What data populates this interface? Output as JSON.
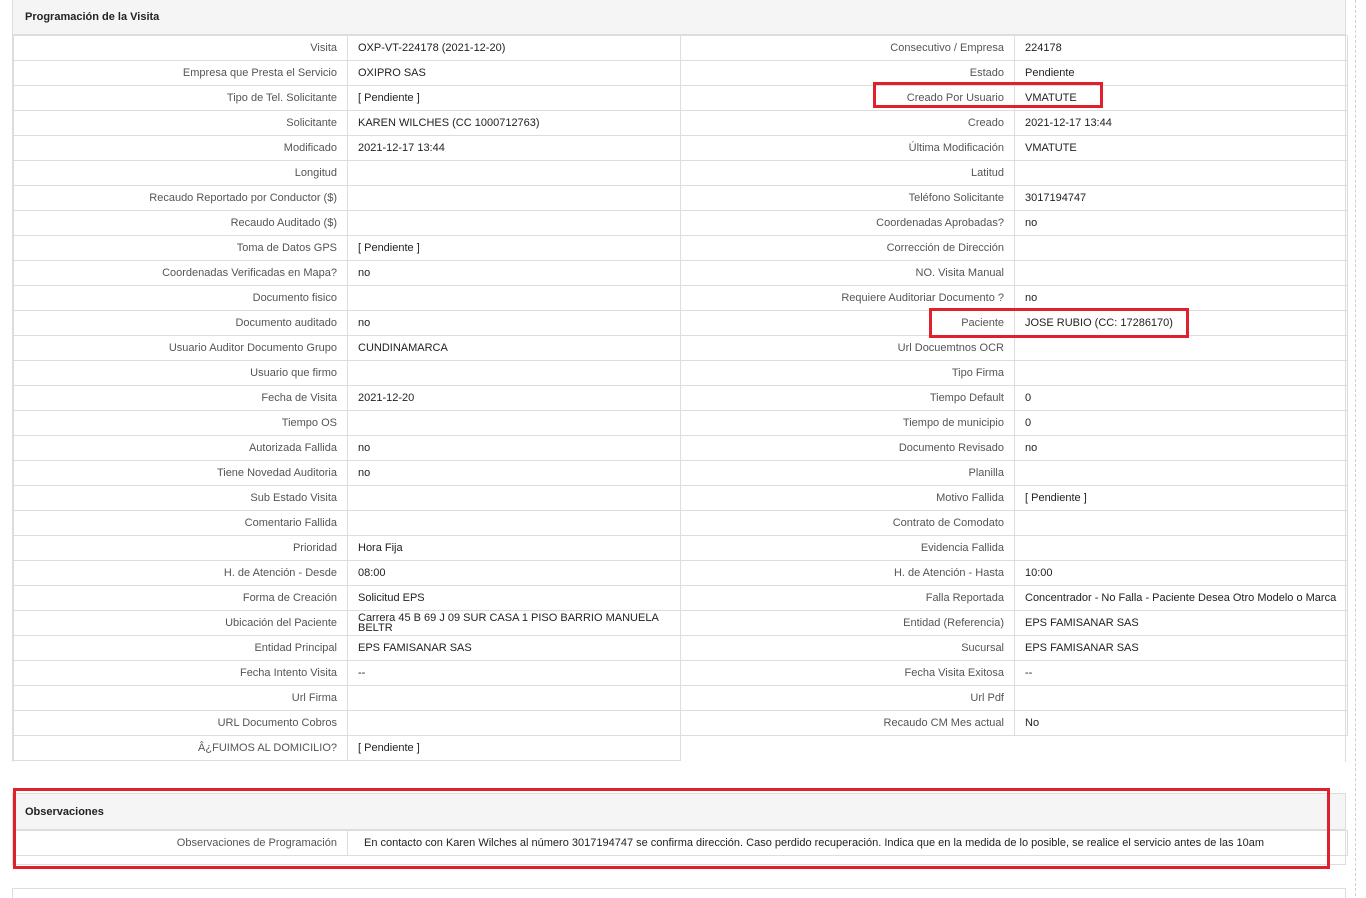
{
  "schedule": {
    "title": "Programación de la Visita",
    "rows": [
      {
        "l1": "Visita",
        "v1": "OXP-VT-224178 (2021-12-20)",
        "l2": "Consecutivo / Empresa",
        "v2": "224178"
      },
      {
        "l1": "Empresa que Presta el Servicio",
        "v1": "OXIPRO SAS",
        "l2": "Estado",
        "v2": "Pendiente"
      },
      {
        "l1": "Tipo de Tel. Solicitante",
        "v1": "[ Pendiente ]",
        "l2": "Creado Por Usuario",
        "v2": "VMATUTE"
      },
      {
        "l1": "Solicitante",
        "v1": "KAREN WILCHES (CC 1000712763)",
        "l2": "Creado",
        "v2": "2021-12-17 13:44"
      },
      {
        "l1": "Modificado",
        "v1": "2021-12-17 13:44",
        "l2": "Última Modificación",
        "v2": " VMATUTE"
      },
      {
        "l1": "Longitud",
        "v1": "",
        "l2": "Latitud",
        "v2": ""
      },
      {
        "l1": "Recaudo Reportado por Conductor ($)",
        "v1": "",
        "l2": "Teléfono Solicitante",
        "v2": "3017194747"
      },
      {
        "l1": "Recaudo Auditado ($)",
        "v1": "",
        "l2": "Coordenadas Aprobadas?",
        "v2": " no"
      },
      {
        "l1": "Toma de Datos GPS",
        "v1": "[ Pendiente ]",
        "l2": "Corrección de Dirección",
        "v2": ""
      },
      {
        "l1": "Coordenadas Verificadas en Mapa?",
        "v1": " no",
        "l2": "NO. Visita Manual",
        "v2": ""
      },
      {
        "l1": "Documento fisico",
        "v1": "",
        "l2": "Requiere Auditoriar Documento ?",
        "v2": " no"
      },
      {
        "l1": "Documento auditado",
        "v1": " no",
        "l2": "Paciente",
        "v2": "JOSE RUBIO (CC: 17286170)"
      },
      {
        "l1": "Usuario Auditor Documento Grupo",
        "v1": "CUNDINAMARCA",
        "l2": "Url Docuemtnos OCR",
        "v2": ""
      },
      {
        "l1": "Usuario que firmo",
        "v1": "",
        "l2": "Tipo Firma",
        "v2": ""
      },
      {
        "l1": "Fecha de Visita",
        "v1": " 2021-12-20",
        "l2": "Tiempo Default",
        "v2": "0"
      },
      {
        "l1": "Tiempo OS",
        "v1": "",
        "l2": "Tiempo de municipio",
        "v2": "0"
      },
      {
        "l1": "Autorizada Fallida",
        "v1": " no",
        "l2": "Documento Revisado",
        "v2": " no"
      },
      {
        "l1": "Tiene Novedad Auditoria",
        "v1": " no",
        "l2": "Planilla",
        "v2": ""
      },
      {
        "l1": "Sub Estado Visita",
        "v1": "",
        "l2": "Motivo Fallida",
        "v2": "[ Pendiente ]"
      },
      {
        "l1": "Comentario Fallida",
        "v1": "",
        "l2": "Contrato de Comodato",
        "v2": ""
      },
      {
        "l1": "Prioridad",
        "v1": "Hora Fija",
        "l2": "Evidencia Fallida",
        "v2": ""
      },
      {
        "l1": "H. de Atención - Desde",
        "v1": "08:00",
        "l2": "H. de Atención - Hasta",
        "v2": "10:00"
      },
      {
        "l1": "Forma de Creación",
        "v1": "Solicitud EPS",
        "l2": "Falla Reportada",
        "v2": "Concentrador - No Falla - Paciente Desea Otro Modelo o Marca"
      },
      {
        "l1": "Ubicación del Paciente",
        "v1": "Carrera 45 B 69 J 09 SUR CASA 1 PISO BARRIO MANUELA BELTR",
        "l2": "Entidad (Referencia)",
        "v2": "EPS FAMISANAR SAS"
      },
      {
        "l1": "Entidad Principal",
        "v1": "EPS FAMISANAR SAS",
        "l2": "Sucursal",
        "v2": "EPS FAMISANAR SAS"
      },
      {
        "l1": "Fecha Intento Visita",
        "v1": " --",
        "l2": "Fecha Visita Exitosa",
        "v2": " --"
      },
      {
        "l1": "Url Firma",
        "v1": "",
        "l2": "Url Pdf",
        "v2": ""
      },
      {
        "l1": "URL Documento Cobros",
        "v1": "",
        "l2": "Recaudo CM Mes actual",
        "v2": "No"
      }
    ],
    "last_row": {
      "l1": "Â¿FUIMOS AL DOMICILIO?",
      "v1": "[ Pendiente ]"
    }
  },
  "observations": {
    "title": "Observaciones",
    "label": "Observaciones de Programación",
    "value": "En contacto con Karen Wilches al número 3017194747 se confirma dirección. Caso perdido recuperación. Indica que en la medida de lo posible, se realice el servicio antes de las 10am"
  },
  "colors": {
    "highlight": "#e0202a",
    "border": "#dddddd",
    "header_bg": "#f5f5f5"
  }
}
